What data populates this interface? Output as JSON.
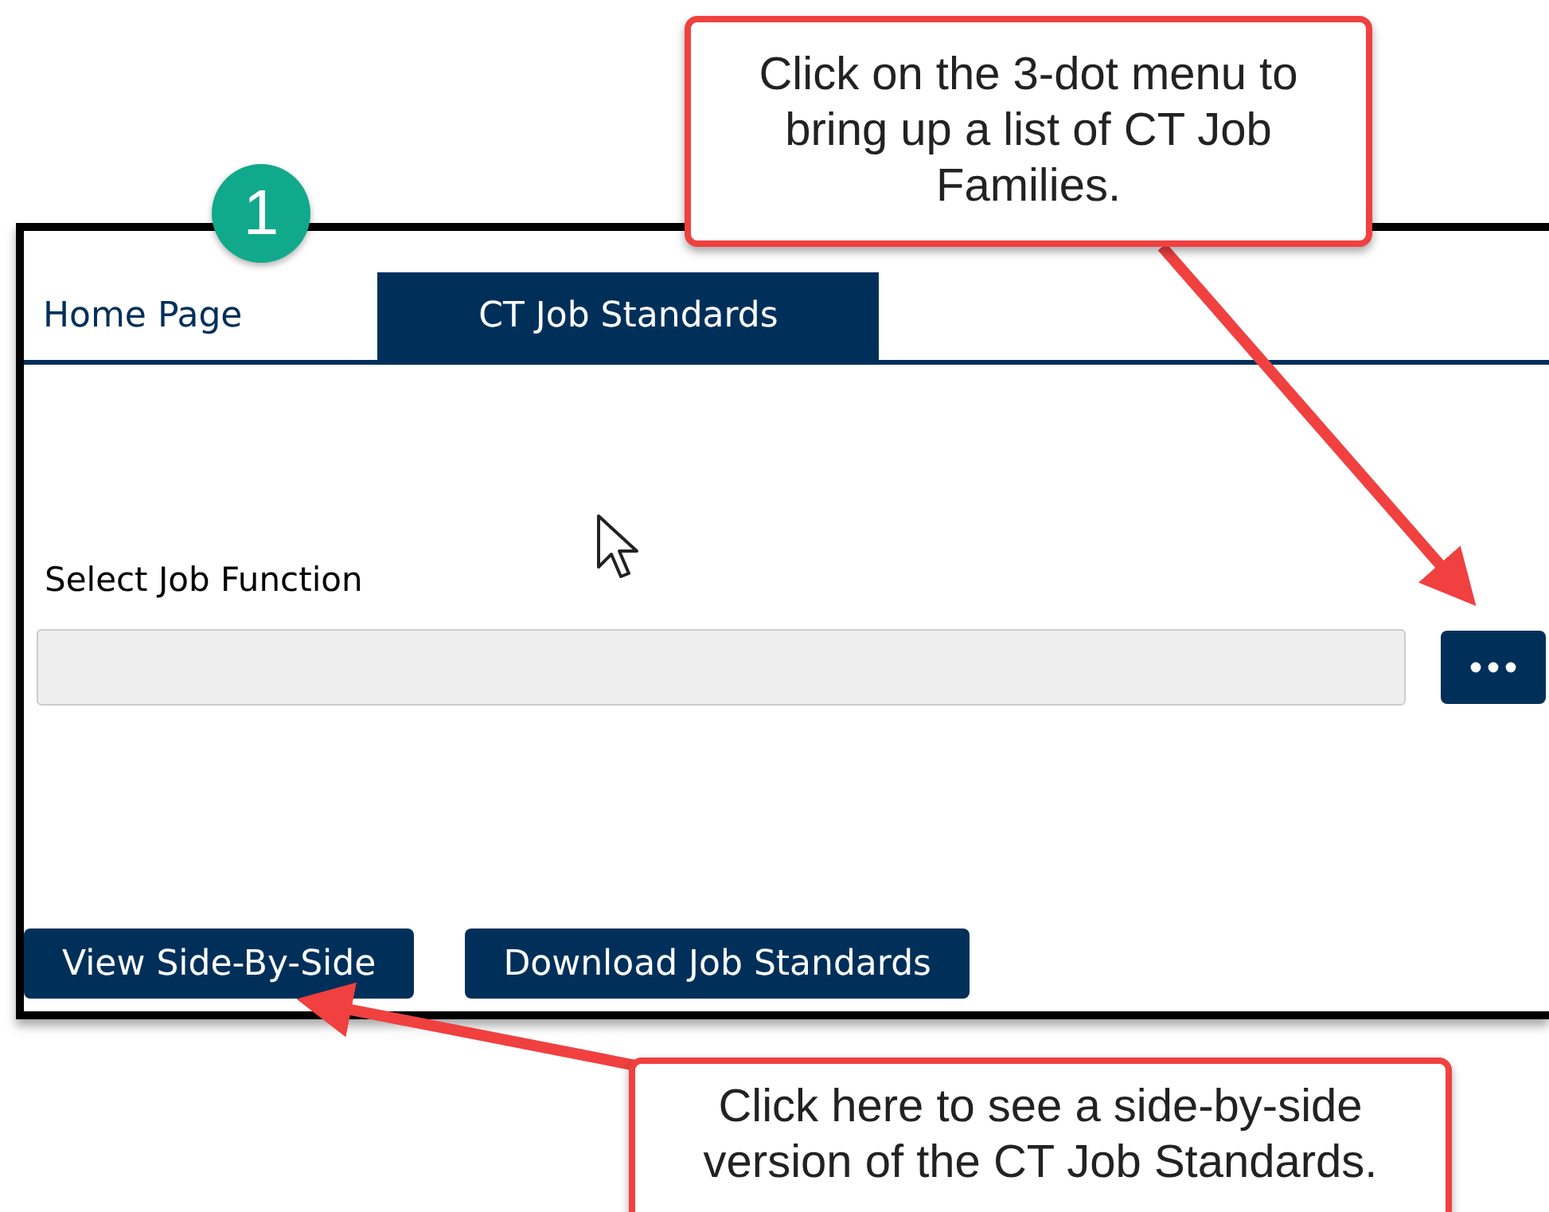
{
  "step_badge": "1",
  "tabs": [
    {
      "label": "Home Page",
      "selected": false
    },
    {
      "label": "CT Job Standards",
      "selected": true
    }
  ],
  "field": {
    "label": "Select Job Function"
  },
  "buttons": [
    "View Side-By-Side",
    "Download Job Standards"
  ],
  "callouts": [
    {
      "text": "Click on the 3-dot menu to bring up a list of CT Job Families."
    },
    {
      "text": "Click here to see a side-by-side version of the CT Job Standards."
    }
  ]
}
